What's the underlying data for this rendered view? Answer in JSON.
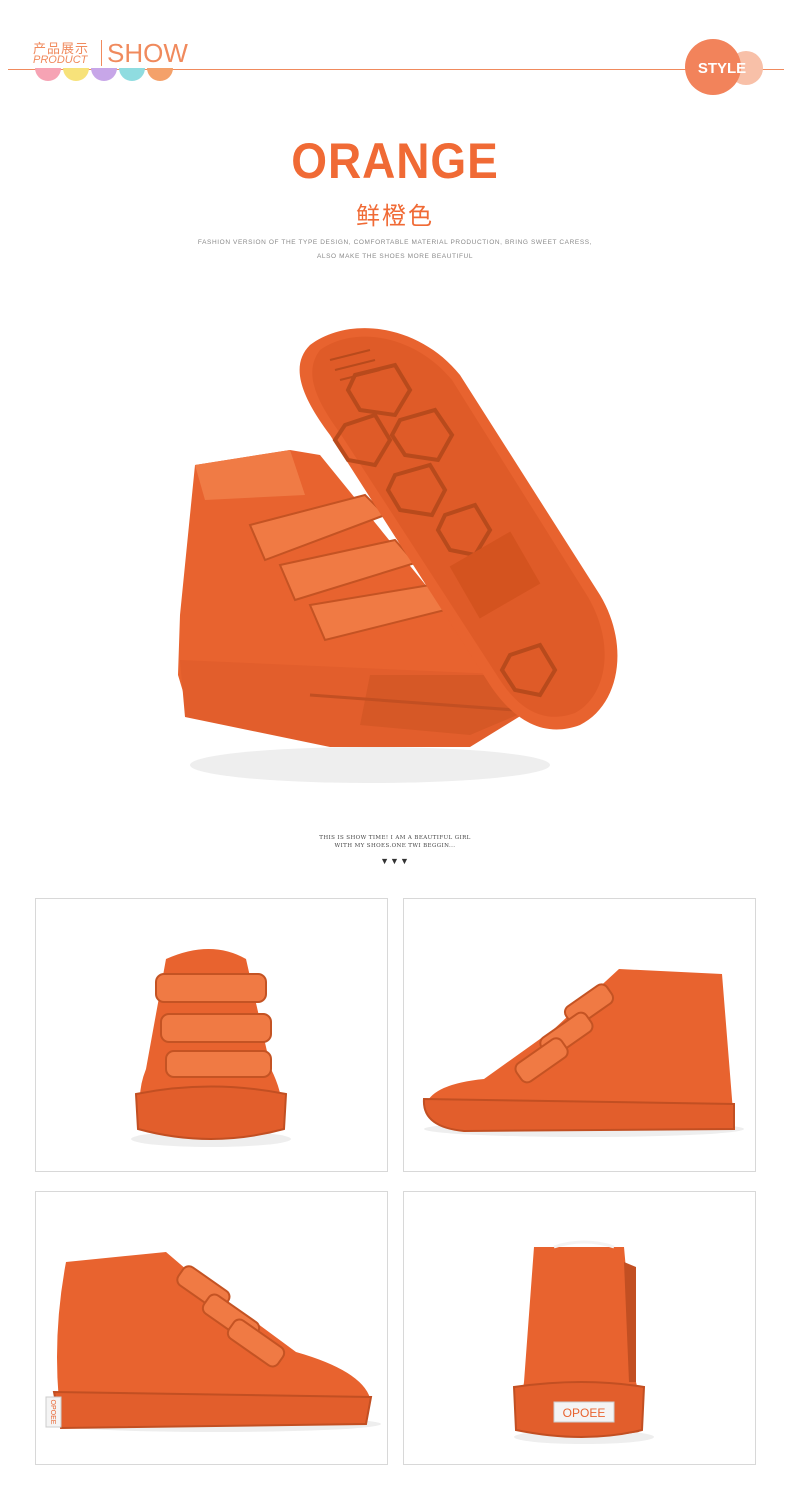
{
  "header": {
    "cn_label": "产品展示",
    "en_label": "PRODUCT",
    "show": "SHOW",
    "badge": "STYLE",
    "dot_colors": [
      "#f6a3b4",
      "#f7e27a",
      "#c7a6e8",
      "#8fdce0",
      "#f4a16a"
    ]
  },
  "title": {
    "main": "ORANGE",
    "cn": "鲜橙色",
    "desc_line1": "FASHION VERSION OF THE TYPE DESIGN, COMFORTABLE MATERIAL PRODUCTION, BRING SWEET CARESS,",
    "desc_line2": "ALSO MAKE THE SHOES MORE BEAUTIFUL"
  },
  "tagline": {
    "line1": "THIS IS SHOW TIME! I AM A BEAUTIFUL GIRL",
    "line2": "WITH MY SHOES.ONE TWI BEGGIN...",
    "arrows": "▼▼▼"
  },
  "gallery": {
    "heel_label_back": "OPOEE",
    "heel_label_side": "OPOEE"
  },
  "colors": {
    "accent": "#f06a35",
    "shoe": "#e8632f",
    "shoe_dark": "#c24f22",
    "shoe_light": "#f27a45"
  }
}
